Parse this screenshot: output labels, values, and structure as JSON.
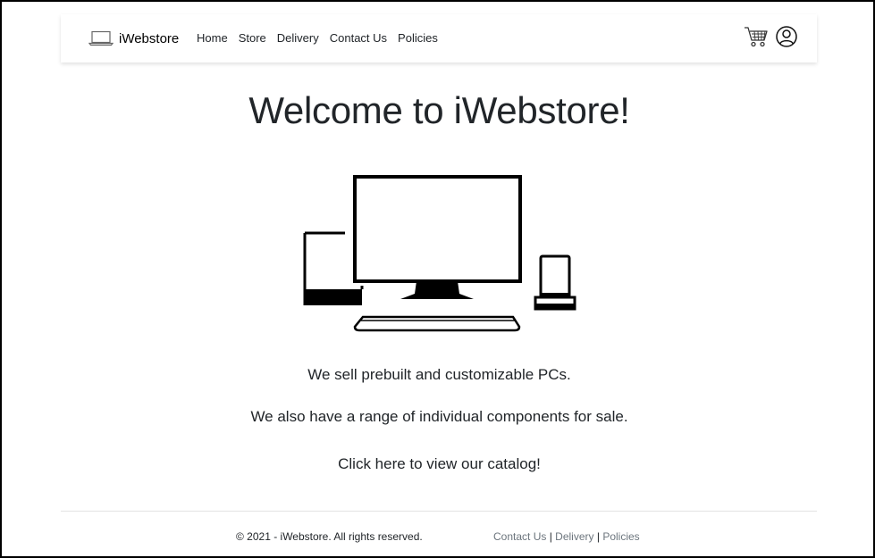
{
  "brand": {
    "name": "iWebstore",
    "icon": "laptop-icon"
  },
  "nav": {
    "items": [
      {
        "label": "Home"
      },
      {
        "label": "Store"
      },
      {
        "label": "Delivery"
      },
      {
        "label": "Contact Us"
      },
      {
        "label": "Policies"
      }
    ],
    "cart_icon": "shopping-cart-icon",
    "account_icon": "user-account-icon"
  },
  "main": {
    "title": "Welcome to iWebstore!",
    "hero_image": "devices-illustration",
    "line1": "We sell prebuilt and customizable PCs.",
    "line2": "We also have a range of individual components for sale.",
    "cta": "Click here to view our catalog!"
  },
  "footer": {
    "copyright": "© 2021 - iWebstore. All rights reserved.",
    "links": [
      {
        "label": "Contact Us"
      },
      {
        "label": "Delivery"
      },
      {
        "label": "Policies"
      }
    ],
    "separator": "|"
  },
  "colors": {
    "text": "#212529",
    "muted_link": "#6c757d",
    "frame_border": "#000000"
  }
}
